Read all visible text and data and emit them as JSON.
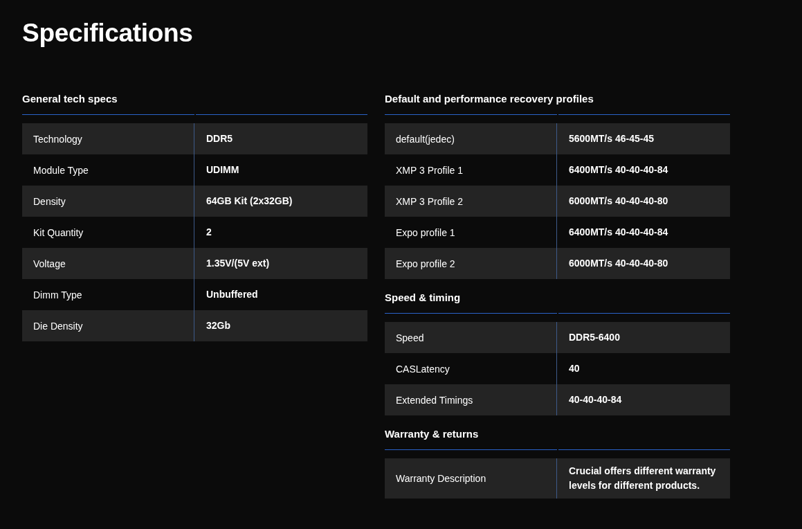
{
  "title": "Specifications",
  "columns": [
    [
      {
        "heading": "General tech specs",
        "rows": [
          {
            "label": "Technology",
            "value": "DDR5"
          },
          {
            "label": "Module Type",
            "value": "UDIMM"
          },
          {
            "label": "Density",
            "value": "64GB Kit (2x32GB)"
          },
          {
            "label": "Kit Quantity",
            "value": "2"
          },
          {
            "label": "Voltage",
            "value": "1.35V/(5V ext)"
          },
          {
            "label": "Dimm Type",
            "value": "Unbuffered"
          },
          {
            "label": "Die Density",
            "value": "32Gb"
          }
        ]
      }
    ],
    [
      {
        "heading": "Default and performance recovery profiles",
        "rows": [
          {
            "label": "default(jedec)",
            "value": "5600MT/s 46-45-45"
          },
          {
            "label": "XMP 3 Profile 1",
            "value": "6400MT/s 40-40-40-84"
          },
          {
            "label": "XMP 3 Profile 2",
            "value": "6000MT/s 40-40-40-80"
          },
          {
            "label": "Expo profile 1",
            "value": "6400MT/s 40-40-40-84"
          },
          {
            "label": "Expo profile 2",
            "value": "6000MT/s 40-40-40-80"
          }
        ]
      },
      {
        "heading": "Speed & timing",
        "rows": [
          {
            "label": "Speed",
            "value": "DDR5-6400"
          },
          {
            "label": "CASLatency",
            "value": "40"
          },
          {
            "label": "Extended Timings",
            "value": "40-40-40-84"
          }
        ]
      },
      {
        "heading": "Warranty & returns",
        "rows": [
          {
            "label": "Warranty Description",
            "value": "Crucial offers different warranty levels for different products."
          }
        ]
      }
    ]
  ]
}
